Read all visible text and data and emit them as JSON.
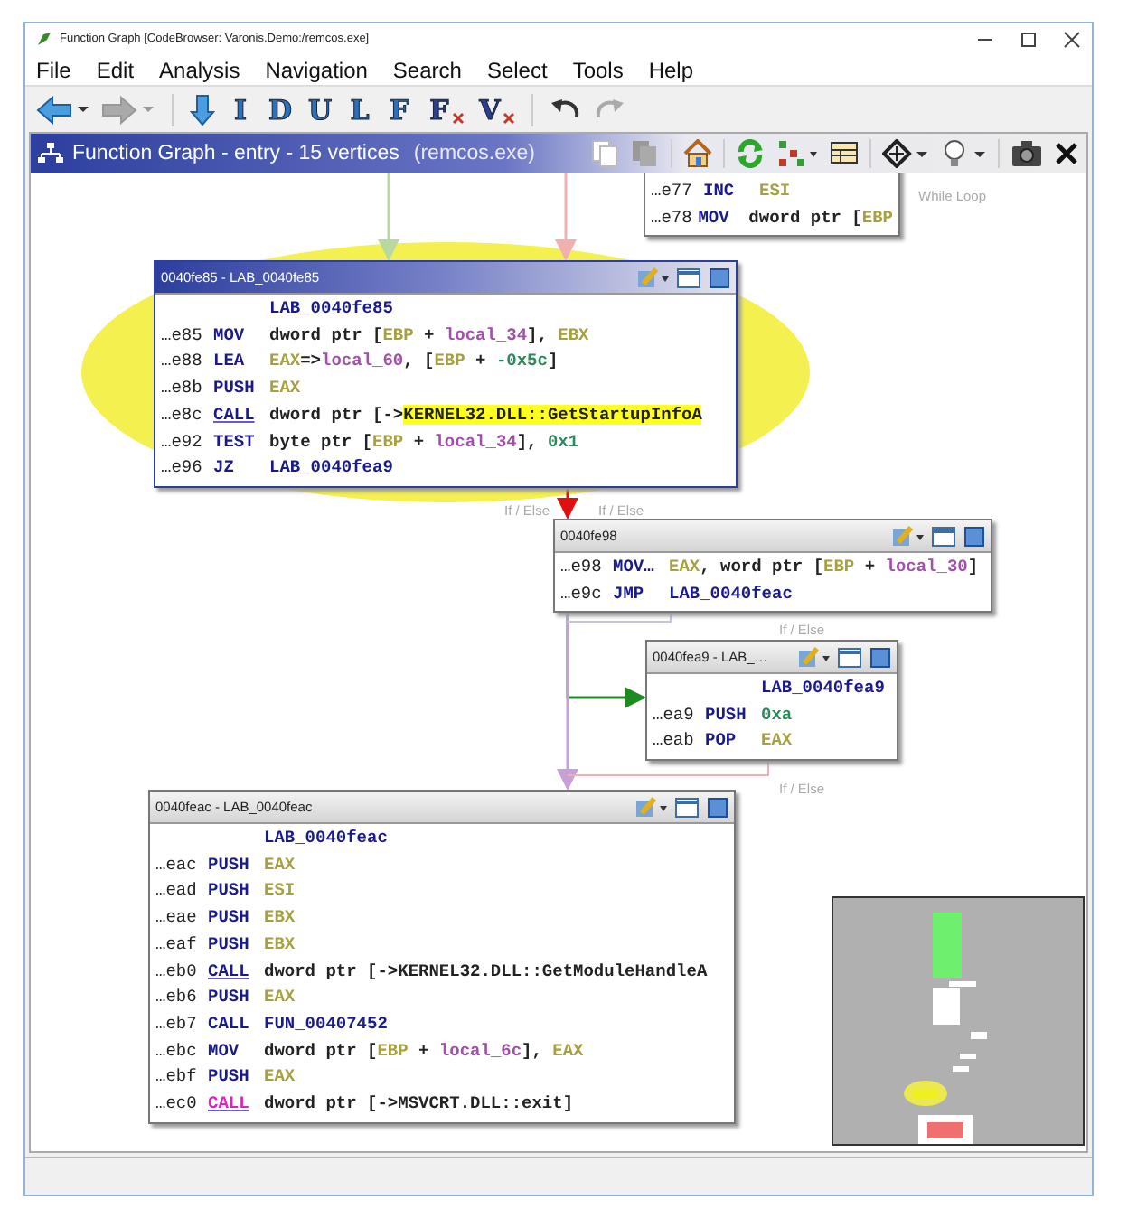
{
  "window": {
    "title": "Function Graph [CodeBrowser: Varonis.Demo:/remcos.exe]"
  },
  "menu": [
    "File",
    "Edit",
    "Analysis",
    "Navigation",
    "Search",
    "Select",
    "Tools",
    "Help"
  ],
  "toolbar": [
    {
      "kind": "back",
      "disabled": false
    },
    {
      "kind": "forward",
      "disabled": true
    },
    {
      "kind": "down",
      "disabled": false
    },
    {
      "kind": "letter",
      "label": "I",
      "disabled": false
    },
    {
      "kind": "letter",
      "label": "D",
      "disabled": false
    },
    {
      "kind": "letter",
      "label": "U",
      "disabled": false
    },
    {
      "kind": "letter",
      "label": "L",
      "disabled": false
    },
    {
      "kind": "letter",
      "label": "F",
      "disabled": false
    },
    {
      "kind": "crossed",
      "label": "F",
      "disabled": false
    },
    {
      "kind": "crossed",
      "label": "V",
      "disabled": false
    },
    {
      "kind": "undo",
      "disabled": false
    },
    {
      "kind": "redo",
      "disabled": true
    }
  ],
  "panel": {
    "title": "Function Graph - entry - 15 vertices",
    "program": "(remcos.exe)"
  },
  "edge_labels": [
    "While Loop",
    "If / Else",
    "If / Else",
    "If / Else",
    "If / Else"
  ],
  "blocks": [
    {
      "lines": [
        {
          "kind": "instruction",
          "addr": "…e77",
          "op": "INC",
          "underlined": false,
          "flagged": false,
          "args": [
            {
              "text": "ESI",
              "kind": "reg"
            }
          ]
        },
        {
          "kind": "instruction",
          "addr": "…e78",
          "op": "MOV",
          "underlined": false,
          "flagged": false,
          "args": [
            {
              "text": "dword ptr [",
              "kind": "text"
            },
            {
              "text": "EBP",
              "kind": "reg"
            }
          ]
        }
      ]
    },
    {
      "title": "0040fe85 - LAB_0040fe85",
      "selected": true,
      "highlighted": true,
      "lines": [
        {
          "kind": "label",
          "text": "LAB_0040fe85"
        },
        {
          "kind": "instruction",
          "addr": "…e85",
          "op": "MOV",
          "underlined": false,
          "flagged": false,
          "args": [
            {
              "text": "dword ptr [",
              "kind": "text"
            },
            {
              "text": "EBP",
              "kind": "reg"
            },
            {
              "text": " + ",
              "kind": "text"
            },
            {
              "text": "local_34",
              "kind": "var"
            },
            {
              "text": "], ",
              "kind": "text"
            },
            {
              "text": "EBX",
              "kind": "reg"
            }
          ]
        },
        {
          "kind": "instruction",
          "addr": "…e88",
          "op": "LEA",
          "underlined": false,
          "flagged": false,
          "args": [
            {
              "text": "EAX",
              "kind": "reg"
            },
            {
              "text": "=>",
              "kind": "text"
            },
            {
              "text": "local_60",
              "kind": "var"
            },
            {
              "text": ", [",
              "kind": "text"
            },
            {
              "text": "EBP",
              "kind": "reg"
            },
            {
              "text": " + ",
              "kind": "text"
            },
            {
              "text": "-0x5c",
              "kind": "num"
            },
            {
              "text": "]",
              "kind": "text"
            }
          ]
        },
        {
          "kind": "instruction",
          "addr": "…e8b",
          "op": "PUSH",
          "underlined": false,
          "flagged": false,
          "args": [
            {
              "text": "EAX",
              "kind": "reg"
            }
          ]
        },
        {
          "kind": "instruction",
          "addr": "…e8c",
          "op": "CALL",
          "underlined": true,
          "flagged": false,
          "args": [
            {
              "text": "dword ptr [->",
              "kind": "text"
            },
            {
              "text": "KERNEL32.DLL::GetStartupInfoA",
              "kind": "match"
            }
          ]
        },
        {
          "kind": "instruction",
          "addr": "…e92",
          "op": "TEST",
          "underlined": false,
          "flagged": false,
          "args": [
            {
              "text": "byte ptr [",
              "kind": "text"
            },
            {
              "text": "EBP",
              "kind": "reg"
            },
            {
              "text": " + ",
              "kind": "text"
            },
            {
              "text": "local_34",
              "kind": "var"
            },
            {
              "text": "], ",
              "kind": "text"
            },
            {
              "text": "0x1",
              "kind": "num"
            }
          ]
        },
        {
          "kind": "instruction",
          "addr": "…e96",
          "op": "JZ",
          "underlined": false,
          "flagged": false,
          "args": [
            {
              "text": "LAB_0040fea9",
              "kind": "label"
            }
          ]
        }
      ]
    },
    {
      "title": "0040fe98",
      "selected": false,
      "highlighted": false,
      "lines": [
        {
          "kind": "instruction",
          "addr": "…e98",
          "op": "MOV…",
          "underlined": false,
          "flagged": false,
          "args": [
            {
              "text": "EAX",
              "kind": "reg"
            },
            {
              "text": ", word ptr [",
              "kind": "text"
            },
            {
              "text": "EBP",
              "kind": "reg"
            },
            {
              "text": " + ",
              "kind": "text"
            },
            {
              "text": "local_30",
              "kind": "var"
            },
            {
              "text": "]",
              "kind": "text"
            }
          ]
        },
        {
          "kind": "instruction",
          "addr": "…e9c",
          "op": "JMP",
          "underlined": false,
          "flagged": false,
          "args": [
            {
              "text": "LAB_0040feac",
              "kind": "label"
            }
          ]
        }
      ]
    },
    {
      "title": "0040fea9 - LAB_…",
      "selected": false,
      "highlighted": false,
      "lines": [
        {
          "kind": "label",
          "text": "LAB_0040fea9"
        },
        {
          "kind": "instruction",
          "addr": "…ea9",
          "op": "PUSH",
          "underlined": false,
          "flagged": false,
          "args": [
            {
              "text": "0xa",
              "kind": "num"
            }
          ]
        },
        {
          "kind": "instruction",
          "addr": "…eab",
          "op": "POP",
          "underlined": false,
          "flagged": false,
          "args": [
            {
              "text": "EAX",
              "kind": "reg"
            }
          ]
        }
      ]
    },
    {
      "title": "0040feac - LAB_0040feac",
      "selected": false,
      "highlighted": false,
      "lines": [
        {
          "kind": "label",
          "text": "LAB_0040feac"
        },
        {
          "kind": "instruction",
          "addr": "…eac",
          "op": "PUSH",
          "underlined": false,
          "flagged": false,
          "args": [
            {
              "text": "EAX",
              "kind": "reg"
            }
          ]
        },
        {
          "kind": "instruction",
          "addr": "…ead",
          "op": "PUSH",
          "underlined": false,
          "flagged": false,
          "args": [
            {
              "text": "ESI",
              "kind": "reg"
            }
          ]
        },
        {
          "kind": "instruction",
          "addr": "…eae",
          "op": "PUSH",
          "underlined": false,
          "flagged": false,
          "args": [
            {
              "text": "EBX",
              "kind": "reg"
            }
          ]
        },
        {
          "kind": "instruction",
          "addr": "…eaf",
          "op": "PUSH",
          "underlined": false,
          "flagged": false,
          "args": [
            {
              "text": "EBX",
              "kind": "reg"
            }
          ]
        },
        {
          "kind": "instruction",
          "addr": "…eb0",
          "op": "CALL",
          "underlined": true,
          "flagged": false,
          "args": [
            {
              "text": "dword ptr [->KERNEL32.DLL::GetModuleHandleA",
              "kind": "text"
            }
          ]
        },
        {
          "kind": "instruction",
          "addr": "…eb6",
          "op": "PUSH",
          "underlined": false,
          "flagged": false,
          "args": [
            {
              "text": "EAX",
              "kind": "reg"
            }
          ]
        },
        {
          "kind": "instruction",
          "addr": "…eb7",
          "op": "CALL",
          "underlined": false,
          "flagged": false,
          "args": [
            {
              "text": "FUN_00407452",
              "kind": "label"
            }
          ]
        },
        {
          "kind": "instruction",
          "addr": "…ebc",
          "op": "MOV",
          "underlined": false,
          "flagged": false,
          "args": [
            {
              "text": "dword ptr [",
              "kind": "text"
            },
            {
              "text": "EBP",
              "kind": "reg"
            },
            {
              "text": " + ",
              "kind": "text"
            },
            {
              "text": "local_6c",
              "kind": "var"
            },
            {
              "text": "], ",
              "kind": "text"
            },
            {
              "text": "EAX",
              "kind": "reg"
            }
          ]
        },
        {
          "kind": "instruction",
          "addr": "…ebf",
          "op": "PUSH",
          "underlined": false,
          "flagged": false,
          "args": [
            {
              "text": "EAX",
              "kind": "reg"
            }
          ]
        },
        {
          "kind": "instruction",
          "addr": "…ec0",
          "op": "CALL",
          "underlined": true,
          "flagged": true,
          "args": [
            {
              "text": "dword ptr [->MSVCRT.DLL::exit]",
              "kind": "text"
            }
          ]
        }
      ]
    }
  ]
}
